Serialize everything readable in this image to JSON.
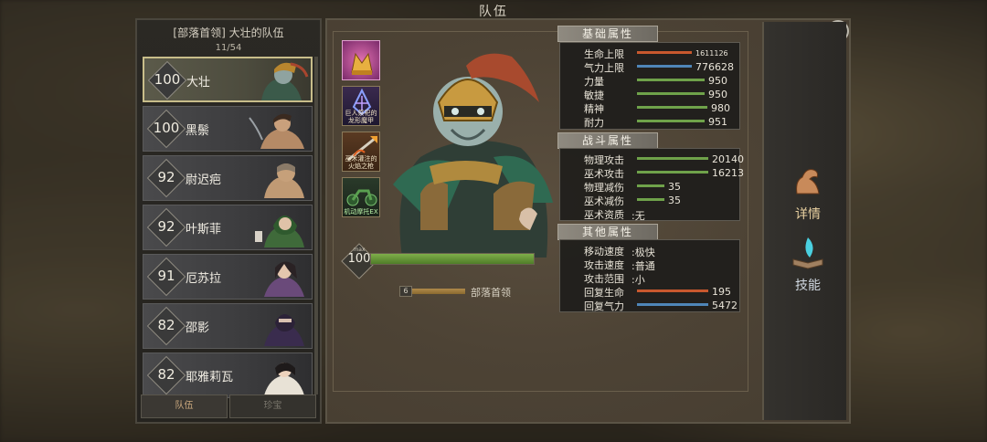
{
  "window": {
    "title": "队伍"
  },
  "roster": {
    "title": "[部落首领] 大壮的队伍",
    "count": "11/54",
    "heroes": [
      {
        "level": "100",
        "name": "大壮",
        "selected": true
      },
      {
        "level": "100",
        "name": "黑鬃"
      },
      {
        "level": "92",
        "name": "尉迟疤"
      },
      {
        "level": "92",
        "name": "叶斯菲"
      },
      {
        "level": "91",
        "name": "厄苏拉"
      },
      {
        "level": "82",
        "name": "邵影"
      },
      {
        "level": "82",
        "name": "耶雅莉瓦"
      }
    ],
    "tabs": [
      {
        "label": "队伍",
        "active": true
      },
      {
        "label": "珍宝",
        "active": false
      }
    ]
  },
  "skills": [
    {
      "name": "",
      "icon": "crown-crystal-icon"
    },
    {
      "name": "巨人祭祀的龙形魔甲",
      "icon": "blue-rune-icon"
    },
    {
      "name": "巫术灌注的火焰之枪",
      "icon": "flame-spear-icon"
    },
    {
      "name": "机动摩托EX",
      "icon": "motorbike-icon"
    }
  ],
  "hero": {
    "max_label": "max",
    "level": "100",
    "exp_fraction": 1.0,
    "rank_number": "6",
    "rank_title": "部落首领"
  },
  "stats": {
    "basic": {
      "heading": "基础属性",
      "rows": [
        {
          "label": "生命上限",
          "value": "1611126",
          "color": "#c8582e",
          "fraction": 0.75
        },
        {
          "label": "气力上限",
          "value": "776628",
          "color": "#4f86b8",
          "fraction": 0.75
        },
        {
          "label": "力量",
          "value": "950",
          "color": "#6fa24a",
          "fraction": 0.93
        },
        {
          "label": "敏捷",
          "value": "950",
          "color": "#6fa24a",
          "fraction": 0.93
        },
        {
          "label": "精神",
          "value": "980",
          "color": "#6fa24a",
          "fraction": 0.96
        },
        {
          "label": "耐力",
          "value": "951",
          "color": "#6fa24a",
          "fraction": 0.93
        }
      ]
    },
    "combat": {
      "heading": "战斗属性",
      "rows": [
        {
          "label": "物理攻击",
          "value": "20140",
          "color": "#6fa24a",
          "fraction": 0.98
        },
        {
          "label": "巫术攻击",
          "value": "16213",
          "color": "#6fa24a",
          "fraction": 0.98
        },
        {
          "label": "物理减伤",
          "value": "35",
          "color": "#6fa24a",
          "fraction": 0.37
        },
        {
          "label": "巫术减伤",
          "value": "35",
          "color": "#6fa24a",
          "fraction": 0.37
        },
        {
          "label": "巫术资质",
          "value": ":无",
          "color": "",
          "fraction": 0
        }
      ]
    },
    "other": {
      "heading": "其他属性",
      "rows": [
        {
          "label": "移动速度",
          "value": ":极快"
        },
        {
          "label": "攻击速度",
          "value": ":普通"
        },
        {
          "label": "攻击范围",
          "value": ":小"
        },
        {
          "label": "回复生命",
          "value": "195",
          "color": "#c8582e",
          "fraction": 0.95
        },
        {
          "label": "回复气力",
          "value": "5472",
          "color": "#4f86b8",
          "fraction": 0.95
        }
      ]
    }
  },
  "side_buttons": [
    {
      "label": "详情",
      "icon": "muscle-arm-icon",
      "active": true
    },
    {
      "label": "技能",
      "icon": "spellbook-icon",
      "active": false
    }
  ],
  "close_glyph": "✕"
}
